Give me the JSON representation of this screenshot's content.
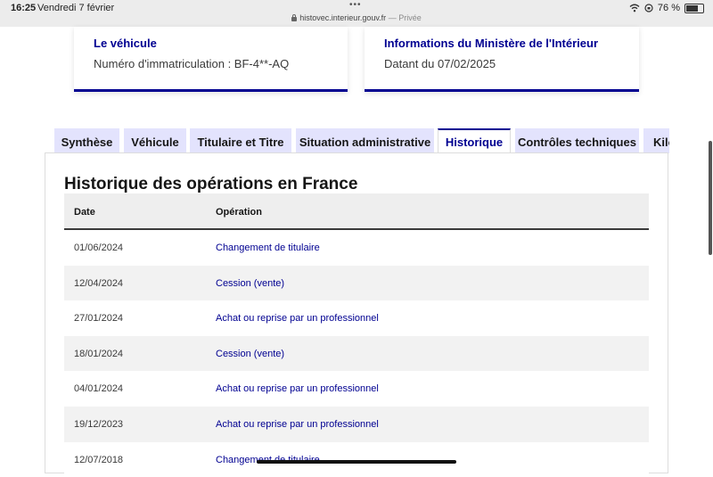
{
  "status_bar": {
    "time": "16:25",
    "date": "Vendredi 7 février",
    "url": "histovec.interieur.gouv.fr",
    "private_label": "— Privée",
    "battery": "76 %"
  },
  "cards": [
    {
      "title": "Le véhicule",
      "text": "Numéro d'immatriculation : BF-4**-AQ"
    },
    {
      "title": "Informations du Ministère de l'Intérieur",
      "text": "Datant du 07/02/2025"
    }
  ],
  "tabs": [
    {
      "label": "Synthèse",
      "active": false
    },
    {
      "label": "Véhicule",
      "active": false
    },
    {
      "label": "Titulaire et Titre",
      "active": false
    },
    {
      "label": "Situation administrative",
      "active": false
    },
    {
      "label": "Historique",
      "active": true
    },
    {
      "label": "Contrôles techniques",
      "active": false
    },
    {
      "label": "Kilométrage",
      "active": false
    }
  ],
  "history": {
    "title": "Historique des opérations en France",
    "columns": {
      "date": "Date",
      "operation": "Opération"
    },
    "rows": [
      {
        "date": "01/06/2024",
        "operation": "Changement de titulaire"
      },
      {
        "date": "12/04/2024",
        "operation": "Cession (vente)"
      },
      {
        "date": "27/01/2024",
        "operation": "Achat ou reprise par un professionnel"
      },
      {
        "date": "18/01/2024",
        "operation": "Cession (vente)"
      },
      {
        "date": "04/01/2024",
        "operation": "Achat ou reprise par un professionnel"
      },
      {
        "date": "19/12/2023",
        "operation": "Achat ou reprise par un professionnel"
      },
      {
        "date": "12/07/2018",
        "operation": "Changement de titulaire"
      }
    ]
  },
  "colors": {
    "accent": "#000091",
    "tab_bg": "#e3e3fd",
    "row_alt": "#f2f2f2"
  }
}
